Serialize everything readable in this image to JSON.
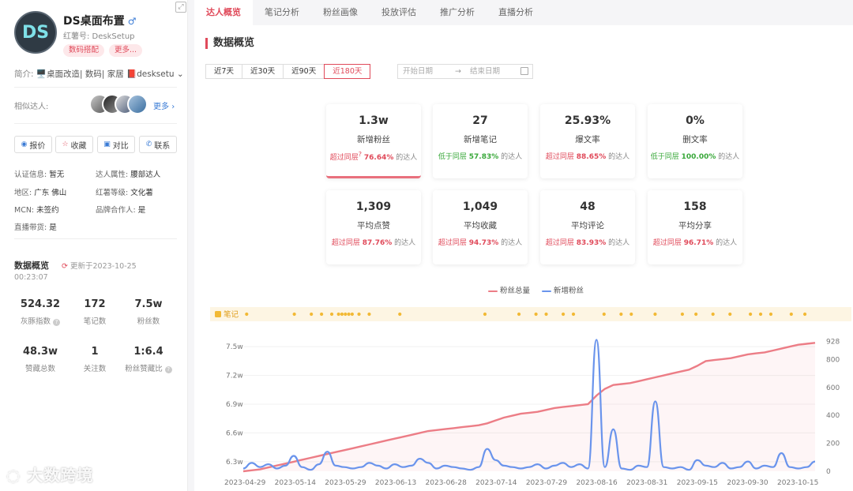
{
  "profile": {
    "avatar_text": "DS",
    "name": "DS桌面布置",
    "gender_symbol": "♂",
    "id_label": "红薯号: DeskSetup",
    "tags": [
      "数码搭配",
      "更多..."
    ],
    "intro_label": "简介:",
    "intro_text": "🖥️桌面改造| 数码| 家居 📕desksetu",
    "similar_label": "相似达人:",
    "more_label": "更多",
    "actions": [
      {
        "icon": "◉",
        "label": "报价"
      },
      {
        "icon": "☆",
        "label": "收藏"
      },
      {
        "icon": "▣",
        "label": "对比"
      },
      {
        "icon": "✆",
        "label": "联系"
      }
    ],
    "info": [
      {
        "label": "认证信息:",
        "value": "暂无"
      },
      {
        "label": "达人属性:",
        "value": "腰部达人"
      },
      {
        "label": "地区:",
        "value": "广东 佛山"
      },
      {
        "label": "红薯等级:",
        "value": "文化薯"
      },
      {
        "label": "MCN:",
        "value": "未签约"
      },
      {
        "label": "品牌合作人:",
        "value": "是"
      },
      {
        "label": "直播带货:",
        "value": "是"
      }
    ]
  },
  "overview": {
    "title": "数据概览",
    "update_text": "更新于2023-10-25",
    "update_time": "00:23:07",
    "stats": [
      {
        "num": "524.32",
        "label": "灰豚指数",
        "help": true
      },
      {
        "num": "172",
        "label": "笔记数",
        "help": false
      },
      {
        "num": "7.5w",
        "label": "粉丝数",
        "help": false
      },
      {
        "num": "48.3w",
        "label": "赞藏总数",
        "help": false
      },
      {
        "num": "1",
        "label": "关注数",
        "help": false
      },
      {
        "num": "1:6.4",
        "label": "粉丝赞藏比",
        "help": true
      }
    ]
  },
  "watermark": "大数跨境",
  "tabs": [
    "达人概览",
    "笔记分析",
    "粉丝画像",
    "投放评估",
    "推广分析",
    "直播分析"
  ],
  "section_title": "数据概览",
  "ranges": [
    "近7天",
    "近30天",
    "近90天",
    "近180天"
  ],
  "active_range": 3,
  "date_start_placeholder": "开始日期",
  "date_end_placeholder": "结束日期",
  "cards": [
    {
      "num": "1.3w",
      "label": "新增粉丝",
      "prefix": "超过同层",
      "pct": "76.64%",
      "suffix": "的达人",
      "dir": "up",
      "q": true
    },
    {
      "num": "27",
      "label": "新增笔记",
      "prefix": "低于同层",
      "pct": "57.83%",
      "suffix": "的达人",
      "dir": "down",
      "q": false
    },
    {
      "num": "25.93%",
      "label": "爆文率",
      "prefix": "超过同层",
      "pct": "88.65%",
      "suffix": "的达人",
      "dir": "up",
      "q": false
    },
    {
      "num": "0%",
      "label": "删文率",
      "prefix": "低于同层",
      "pct": "100.00%",
      "suffix": "的达人",
      "dir": "down",
      "q": false
    },
    {
      "num": "1,309",
      "label": "平均点赞",
      "prefix": "超过同层",
      "pct": "87.76%",
      "suffix": "的达人",
      "dir": "up",
      "q": false
    },
    {
      "num": "1,049",
      "label": "平均收藏",
      "prefix": "超过同层",
      "pct": "94.73%",
      "suffix": "的达人",
      "dir": "up",
      "q": false
    },
    {
      "num": "48",
      "label": "平均评论",
      "prefix": "超过同层",
      "pct": "83.93%",
      "suffix": "的达人",
      "dir": "up",
      "q": false
    },
    {
      "num": "158",
      "label": "平均分享",
      "prefix": "超过同层",
      "pct": "96.71%",
      "suffix": "的达人",
      "dir": "up",
      "q": false
    }
  ],
  "chart_data": {
    "type": "line",
    "notes_label": "笔记",
    "series": [
      {
        "name": "粉丝总量",
        "color": "#ec7d86",
        "axis": "left",
        "y": [
          6.2,
          6.21,
          6.22,
          6.24,
          6.26,
          6.28,
          6.3,
          6.32,
          6.34,
          6.36,
          6.38,
          6.4,
          6.42,
          6.44,
          6.46,
          6.48,
          6.5,
          6.52,
          6.54,
          6.56,
          6.58,
          6.6,
          6.62,
          6.63,
          6.64,
          6.65,
          6.66,
          6.67,
          6.68,
          6.7,
          6.73,
          6.76,
          6.78,
          6.8,
          6.81,
          6.82,
          6.84,
          6.86,
          6.87,
          6.88,
          6.89,
          6.9,
          6.99,
          7.06,
          7.1,
          7.11,
          7.12,
          7.14,
          7.16,
          7.18,
          7.2,
          7.22,
          7.24,
          7.26,
          7.3,
          7.35,
          7.36,
          7.37,
          7.38,
          7.4,
          7.42,
          7.43,
          7.44,
          7.46,
          7.48,
          7.5,
          7.52,
          7.53,
          7.54
        ]
      },
      {
        "name": "新增粉丝",
        "color": "#6a94ec",
        "axis": "right",
        "y": [
          20,
          60,
          30,
          50,
          20,
          40,
          110,
          30,
          10,
          50,
          140,
          40,
          30,
          20,
          30,
          60,
          40,
          20,
          50,
          30,
          40,
          90,
          60,
          20,
          40,
          30,
          20,
          10,
          30,
          160,
          80,
          40,
          30,
          20,
          30,
          50,
          20,
          40,
          60,
          30,
          50,
          20,
          940,
          30,
          300,
          20,
          10,
          40,
          30,
          500,
          30,
          20,
          30,
          10,
          80,
          40,
          30,
          60,
          20,
          30,
          70,
          20,
          40,
          30,
          130,
          30,
          20,
          30,
          70
        ]
      }
    ],
    "x_labels": [
      "2023-04-29",
      "2023-05-14",
      "2023-05-29",
      "2023-06-13",
      "2023-06-28",
      "2023-07-14",
      "2023-07-29",
      "2023-08-16",
      "2023-08-31",
      "2023-09-15",
      "2023-09-30",
      "2023-10-15"
    ],
    "y_left_labels": [
      "6.3w",
      "6.6w",
      "6.9w",
      "7.2w",
      "7.5w"
    ],
    "y_left_range": [
      6.2,
      7.6
    ],
    "y_right_labels": [
      "0",
      "200",
      "400",
      "600",
      "800",
      "928"
    ],
    "y_right_range": [
      0,
      960
    ],
    "note_markers": [
      0.01,
      0.15,
      0.2,
      0.23,
      0.26,
      0.28,
      0.29,
      0.3,
      0.31,
      0.32,
      0.34,
      0.37,
      0.46,
      0.71,
      0.81,
      0.86,
      0.89,
      0.94,
      0.97,
      1.06,
      1.11,
      1.14,
      1.21,
      1.29,
      1.33,
      1.38,
      1.43,
      1.49,
      1.52,
      1.55,
      1.61,
      1.65
    ]
  }
}
